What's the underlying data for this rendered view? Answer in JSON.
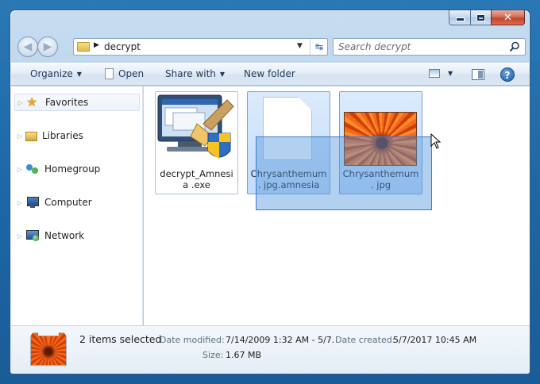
{
  "window": {
    "title_buttons": {
      "minimize": "minimize-icon",
      "maximize": "maximize-icon",
      "close": "✕"
    }
  },
  "address_bar": {
    "path": "decrypt",
    "refresh_icon": "↹"
  },
  "search": {
    "placeholder": "Search decrypt"
  },
  "toolbar": {
    "organize": "Organize",
    "open": "Open",
    "share_with": "Share with",
    "new_folder": "New folder",
    "help": "?"
  },
  "nav_pane": {
    "items": [
      {
        "label": "Favorites",
        "icon": "star-icon",
        "selected": true
      },
      {
        "label": "Libraries",
        "icon": "libraries-icon"
      },
      {
        "label": "Homegroup",
        "icon": "homegroup-icon"
      },
      {
        "label": "Computer",
        "icon": "computer-icon"
      },
      {
        "label": "Network",
        "icon": "network-icon"
      }
    ]
  },
  "files": [
    {
      "name": "decrypt_Amnesia .exe",
      "icon": "installer-exe-icon",
      "selected": false
    },
    {
      "name": "Chrysanthemum. jpg.amnesia",
      "icon": "blank-document-icon",
      "selected": true
    },
    {
      "name": "Chrysanthemum. jpg",
      "icon": "chrysanthemum-photo-thumbnail",
      "selected": true
    }
  ],
  "details": {
    "count": "2 items selected",
    "date_modified_label": "Date modified:",
    "date_modified_value": "7/14/2009 1:32 AM - 5/7...",
    "date_created_label": "Date created:",
    "date_created_value": "5/7/2017 10:45 AM",
    "size_label": "Size:",
    "size_value": "1.67 MB"
  },
  "colors": {
    "desktop": "#1d67a6",
    "selection": "#c1dcfc",
    "drag_rect": "#5496dc"
  }
}
